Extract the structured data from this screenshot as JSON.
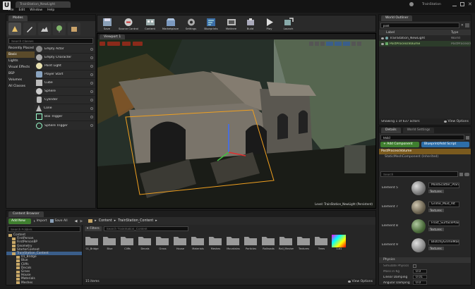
{
  "app": {
    "logo_text": "U",
    "title": "TrainStation_NewLight",
    "project": "TrainStation"
  },
  "menu": [
    "File",
    "Edit",
    "Window",
    "Help"
  ],
  "modes": {
    "tab": "Modes",
    "search_placeholder": "Search Classes",
    "categories": [
      "Recently Placed",
      "Basic",
      "Lights",
      "Visual Effects",
      "BSP",
      "Volumes",
      "All Classes"
    ],
    "selected_category": "Basic",
    "items": [
      "Empty Actor",
      "Empty Character",
      "Point Light",
      "Player Start",
      "Cube",
      "Sphere",
      "Cylinder",
      "Cone",
      "Box Trigger",
      "Sphere Trigger"
    ]
  },
  "toolbar": {
    "buttons": [
      "Save",
      "Source Control",
      "Content",
      "Marketplace",
      "Settings",
      "Blueprints",
      "Matinee",
      "Build",
      "Play",
      "Launch"
    ]
  },
  "viewport": {
    "tab": "Viewport 1",
    "level_label": "Level: TrainStation_NewLight (Persistent)"
  },
  "outliner": {
    "tab": "World Outliner",
    "search_value": "post",
    "col_label": "Label",
    "col_type": "Type",
    "rows": [
      {
        "label": "TrainStation_NewLight",
        "type": "World"
      },
      {
        "label": "PostProcessVolume",
        "type": "PostProcessVolume"
      }
    ],
    "status": "Showing 1 of 637 actors",
    "view_options": "View Options"
  },
  "details": {
    "tabs": [
      "Details",
      "World Settings"
    ],
    "name_value": "Mold",
    "add_component": "+ Add Component",
    "blueprint_button": "Blueprint/Add Script",
    "component_root": "PostProcessVolume",
    "component_child": "StaticMeshComponent (Inherited)",
    "search_placeholder": "Search",
    "elements": [
      {
        "label": "Element 5",
        "asset": "MoldScatter_Plane",
        "action": "Textures"
      },
      {
        "label": "Element 7",
        "asset": "Grime_Mud_Alt",
        "action": "Textures"
      },
      {
        "label": "Element 8",
        "asset": "Frost_SurfacePlain",
        "action": "Textures"
      },
      {
        "label": "Element 9",
        "asset": "BlotchyGrimeMask",
        "action": "Textures"
      }
    ],
    "physics_header": "Physics",
    "physics_rows": [
      {
        "label": "Simulate Physics",
        "value": ""
      },
      {
        "label": "Mass in Kg",
        "value": "0.0"
      },
      {
        "label": "Linear Damping",
        "value": "0.01"
      },
      {
        "label": "Angular Damping",
        "value": "0.0"
      }
    ]
  },
  "content_browser": {
    "tab": "Content Browser",
    "add_new": "Add New",
    "import": "Import",
    "save_all": "Save All",
    "breadcrumb": [
      "Content",
      "TrainStation_Content"
    ],
    "folder_search_placeholder": "Search Folders",
    "filters": "Filters",
    "asset_search_placeholder": "Search TrainStation_Content",
    "tree": [
      "Content",
      "FirstPerson",
      "FirstPersonBP",
      "Geometry",
      "StarterContent",
      "TrainStation_Content",
      "01_Bridge",
      "Blue",
      "Cliffs",
      "Decals",
      "Grass",
      "House",
      "Materials",
      "Meshes"
    ],
    "assets": [
      "01_Bridge",
      "Blue",
      "Cliffs",
      "Decals",
      "Grass",
      "House",
      "Materials",
      "Meshes",
      "Mountains",
      "Particles",
      "Railroads",
      "Rail_Meshes",
      "Textures",
      "Trees",
      "Lut1"
    ],
    "count": "15 items",
    "view_options": "View Options"
  }
}
